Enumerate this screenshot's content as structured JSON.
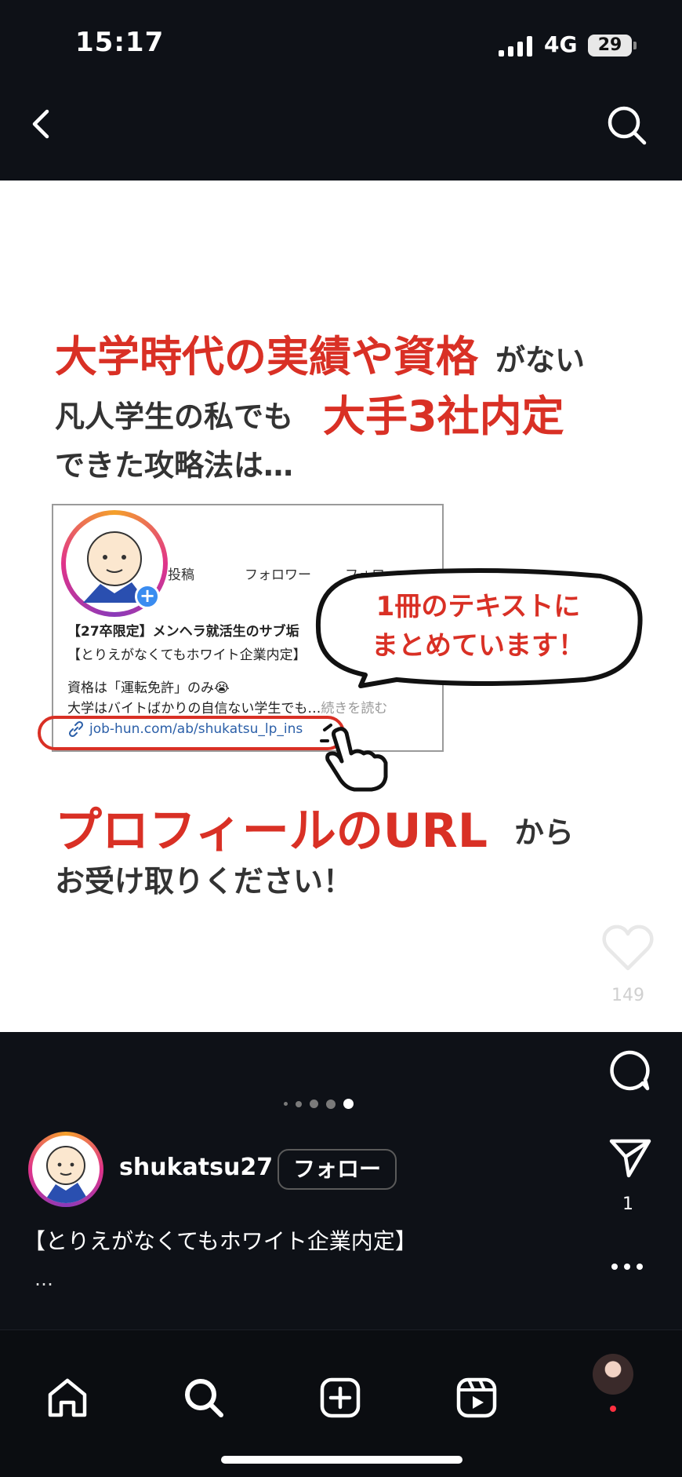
{
  "status_bar": {
    "time": "15:17",
    "network": "4G",
    "battery": "29"
  },
  "post": {
    "headline": {
      "line1_red": "大学時代の実績や資格",
      "line1_dark": "がない",
      "line2_dark": "凡人学生の私でも",
      "line2_red": "大手3社内定",
      "line3_dark": "できた攻略法は…"
    },
    "profile_card": {
      "stats": [
        "投稿",
        "フォロワー",
        "フォロー"
      ],
      "bio_line1": "【27卒限定】メンヘラ就活生のサブ垢",
      "bio_line2": "【とりえがなくてもホワイト企業内定】",
      "bio_line3": "資格は「運転免許」のみ😭",
      "bio_line4": "大学はバイトばかりの自信ない学生でも…",
      "more_label": "続きを読む",
      "link": "job-hun.com/ab/shukatsu_lp_ins"
    },
    "bubble": {
      "line1": "1冊のテキストに",
      "line2": "まとめています！"
    },
    "cta": {
      "red": "プロフィールのURL",
      "dark_suffix": "から",
      "line2": "お受け取りください！"
    }
  },
  "actions": {
    "like_count": "149",
    "share_count": "1"
  },
  "carousel": {
    "total": 5,
    "active_index": 4
  },
  "author": {
    "username": "shukatsu27",
    "follow_label": "フォロー"
  },
  "caption": {
    "text": "【とりえがなくてもホワイト企業内定】",
    "ellipsis": "…"
  },
  "colors": {
    "accent_red": "#d93025",
    "background": "#0e1117",
    "notification_dot": "#ff3040"
  }
}
